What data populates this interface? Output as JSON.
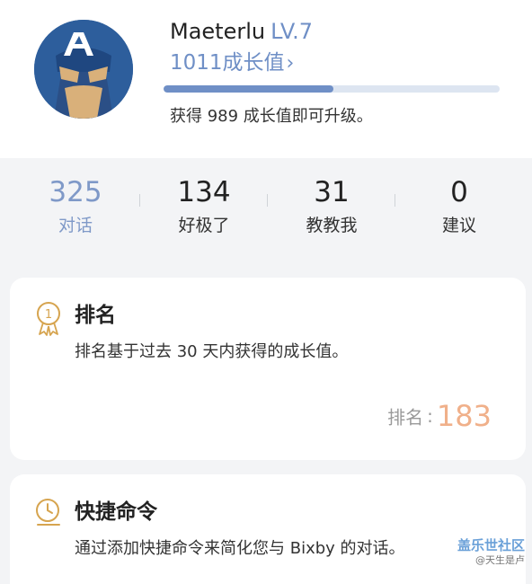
{
  "profile": {
    "username": "Maeterlu",
    "level": "LV.7",
    "growth_value": "1011成长值",
    "progress_fraction": 0.505,
    "upgrade_text": "获得 989 成长值即可升级。"
  },
  "stats": [
    {
      "value": "325",
      "label": "对话",
      "active": true
    },
    {
      "value": "134",
      "label": "好极了",
      "active": false
    },
    {
      "value": "31",
      "label": "教教我",
      "active": false
    },
    {
      "value": "0",
      "label": "建议",
      "active": false
    }
  ],
  "ranking_card": {
    "title": "排名",
    "description": "排名基于过去 30 天内获得的成长值。",
    "rank_label": "排名",
    "rank_value": "183",
    "badge_number": "1"
  },
  "shortcut_card": {
    "title": "快捷命令",
    "description": "通过添加快捷命令来简化您与 Bixby 的对话。"
  },
  "watermark": {
    "main": "盖乐世社区",
    "sub": "@天生是卢"
  },
  "colors": {
    "accent_blue": "#6f8fc6",
    "rank_orange": "#f0b08a",
    "icon_gold": "#d6a44f"
  }
}
